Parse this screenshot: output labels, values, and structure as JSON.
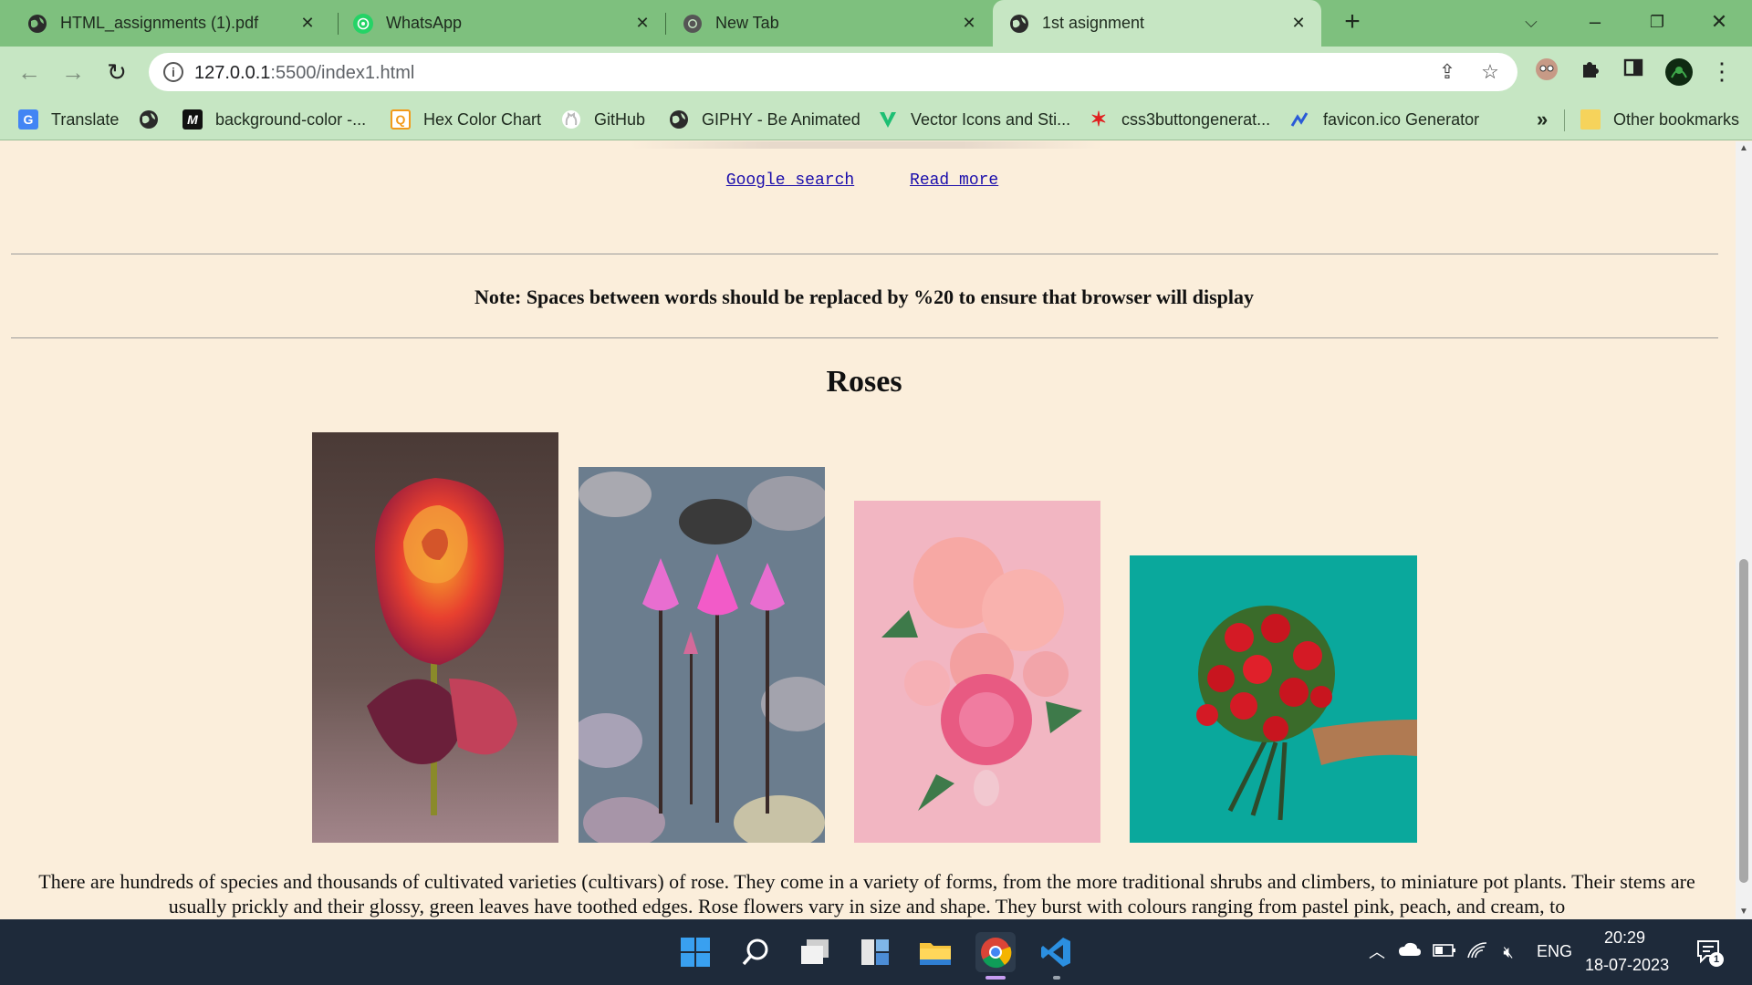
{
  "browser": {
    "tabs": [
      {
        "title": "HTML_assignments (1).pdf",
        "icon": "globe-icon",
        "active": false
      },
      {
        "title": "WhatsApp",
        "icon": "whatsapp-icon",
        "active": false
      },
      {
        "title": "New Tab",
        "icon": "chrome-icon",
        "active": false
      },
      {
        "title": "1st asignment",
        "icon": "globe-icon",
        "active": true
      }
    ],
    "new_tab_label": "+",
    "url": "127.0.0.1:5500/index1.html",
    "url_host": "127.0.0.1",
    "url_rest": ":5500/index1.html",
    "bookmarks": [
      {
        "label": "Translate",
        "icon": "google-translate-icon"
      },
      {
        "label": "",
        "icon": "globe-icon"
      },
      {
        "label": "background-color -...",
        "icon": "mdn-icon"
      },
      {
        "label": "Hex Color Chart",
        "icon": "hex-color-icon"
      },
      {
        "label": "GitHub",
        "icon": "github-icon"
      },
      {
        "label": "GIPHY - Be Animated",
        "icon": "globe-icon"
      },
      {
        "label": "Vector Icons and Sti...",
        "icon": "vector-icon"
      },
      {
        "label": "css3buttongenerat...",
        "icon": "star-burst-icon"
      },
      {
        "label": "favicon.ico Generator",
        "icon": "favicon-generator-icon"
      }
    ],
    "bookmarks_overflow": "»",
    "other_bookmarks": "Other bookmarks"
  },
  "page": {
    "links": [
      {
        "label": "Google search"
      },
      {
        "label": "Read more"
      }
    ],
    "note": "Note: Spaces between words should be replaced by %20 to ensure that browser will display",
    "heading": "Roses",
    "images": [
      {
        "name": "rose-image",
        "description_icon": "orange-red rose"
      },
      {
        "name": "water-lily-image",
        "description_icon": "pink water lilies"
      },
      {
        "name": "peony-bouquet-image",
        "description_icon": "pink peonies"
      },
      {
        "name": "red-rose-bouquet-image",
        "description_icon": "hand holding red roses"
      }
    ],
    "paragraph": "There are hundreds of species and thousands of cultivated varieties (cultivars) of rose. They come in a variety of forms, from the more traditional shrubs and climbers, to miniature pot plants. Their stems are usually prickly and their glossy, green leaves have toothed edges. Rose flowers vary in size and shape. They burst with colours ranging from pastel pink, peach, and cream, to"
  },
  "taskbar": {
    "language": "ENG",
    "time": "20:29",
    "date": "18-07-2023",
    "notification_count": "1"
  },
  "colors": {
    "tab_strip": "#7ec07e",
    "toolbar": "#c6e6c3",
    "page_background": "#fbeedb",
    "link": "#1a0dab",
    "taskbar": "#1e2a3a"
  }
}
